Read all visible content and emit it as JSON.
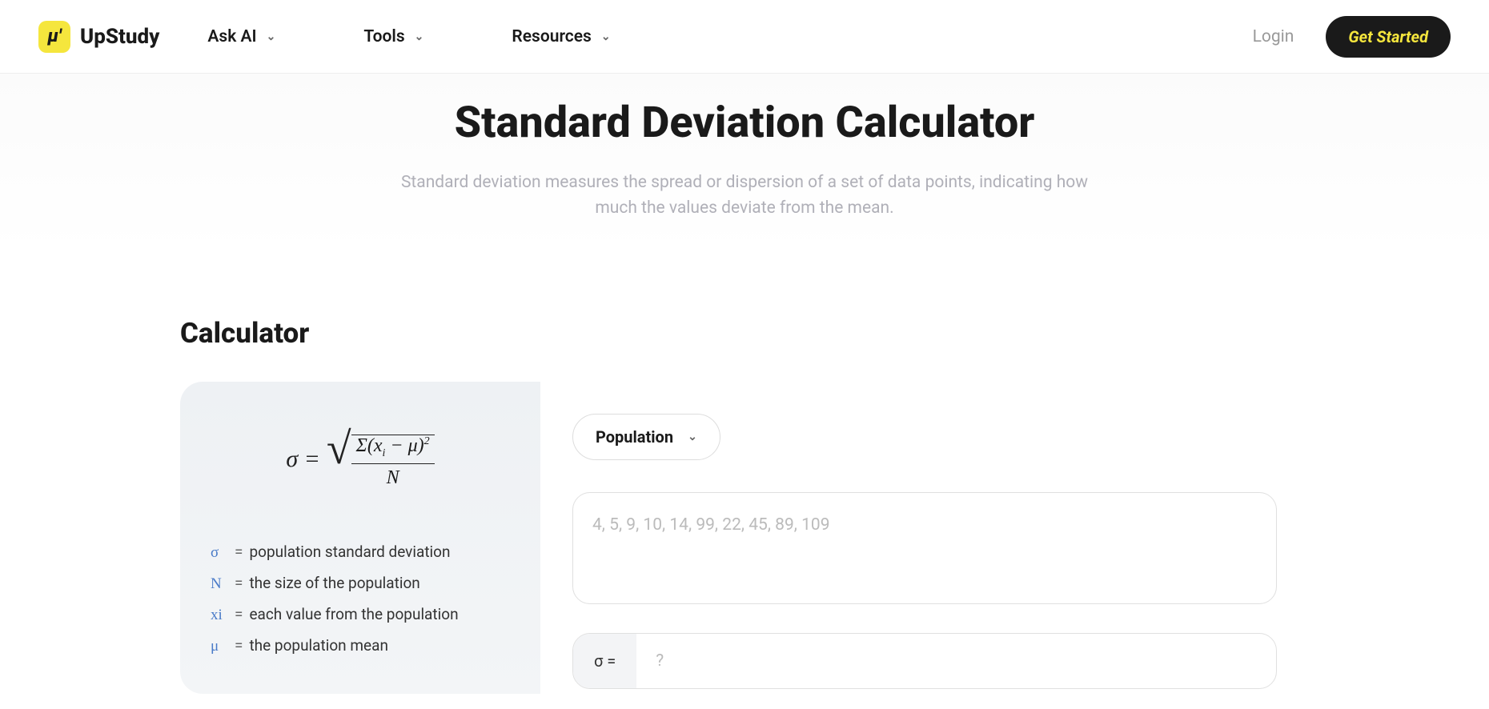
{
  "header": {
    "brand": "UpStudy",
    "logo_glyph": "μ'",
    "nav": [
      {
        "label": "Ask AI"
      },
      {
        "label": "Tools"
      },
      {
        "label": "Resources"
      }
    ],
    "login": "Login",
    "cta": "Get Started"
  },
  "hero": {
    "title": "Standard Deviation Calculator",
    "subtitle": "Standard deviation measures the spread or dispersion of a set of data points, indicating how much the values deviate from the mean."
  },
  "section": {
    "title": "Calculator"
  },
  "formula": {
    "lhs": "σ =",
    "numerator_prefix": "Σ(",
    "x": "x",
    "x_sub": "i",
    "minus": " − ",
    "mu": "μ",
    "paren_close": ")",
    "sq": "2",
    "denominator": "N"
  },
  "legend": [
    {
      "sym": "σ",
      "txt": "population standard deviation"
    },
    {
      "sym": "N",
      "txt": "the size of the population"
    },
    {
      "sym": "xi",
      "txt": "each value from the population"
    },
    {
      "sym": "μ",
      "txt": "the population mean"
    }
  ],
  "calc": {
    "mode": "Population",
    "input_placeholder": "4, 5, 9, 10, 14, 99, 22, 45, 89, 109",
    "result_label": "σ =",
    "result_placeholder": "?"
  }
}
